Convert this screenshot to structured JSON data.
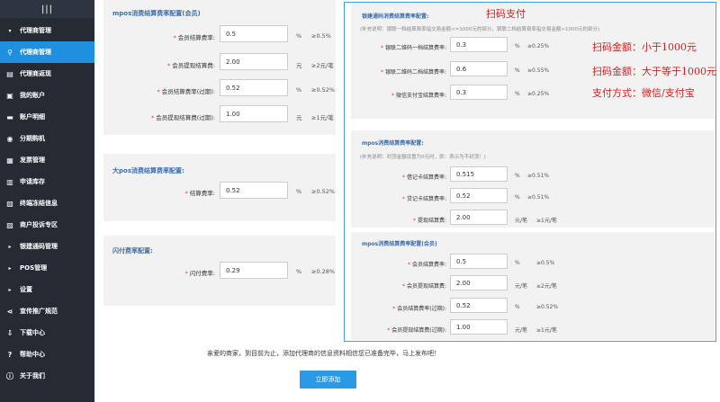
{
  "sidebar": {
    "top_icon": "|||",
    "items": [
      {
        "label": "代理商管理",
        "icon": "▾"
      },
      {
        "label": "代理商管理",
        "icon": "⚲"
      },
      {
        "label": "代理商返现",
        "icon": "▤"
      },
      {
        "label": "我的账户",
        "icon": "▣"
      },
      {
        "label": "账户明细",
        "icon": "▬"
      },
      {
        "label": "分期购机",
        "icon": "◉"
      },
      {
        "label": "发票管理",
        "icon": "▦"
      },
      {
        "label": "申请库存",
        "icon": "▥"
      },
      {
        "label": "终端冻结信息",
        "icon": "▧"
      },
      {
        "label": "商户投诉专区",
        "icon": "▨"
      },
      {
        "label": "银建通码管理",
        "icon": "▸"
      },
      {
        "label": "POS管理",
        "icon": "▸"
      },
      {
        "label": "设置",
        "icon": "▸"
      },
      {
        "label": "宣传推广规范",
        "icon": "⋖"
      },
      {
        "label": "下载中心",
        "icon": "⇩"
      },
      {
        "label": "帮助中心",
        "icon": "?"
      },
      {
        "label": "关于我们",
        "icon": "ⓘ"
      }
    ]
  },
  "mpos_member": {
    "title": "mpos消费结算费率配置(会员)",
    "rows": [
      {
        "label": "会员结算费率:",
        "value": "0.5",
        "unit": "%",
        "range": "≥0.5%"
      },
      {
        "label": "会员提现结算费:",
        "value": "2.00",
        "unit": "元",
        "range": "≥2元/笔"
      },
      {
        "label": "会员结算费率(过期):",
        "value": "0.52",
        "unit": "%",
        "range": "≥0.52%"
      },
      {
        "label": "会员提现结算费(过期):",
        "value": "1.00",
        "unit": "元",
        "range": "≥1元/笔"
      }
    ]
  },
  "big_pos": {
    "title": "大pos消费结算费率配置:",
    "rows": [
      {
        "label": "结算费率:",
        "value": "0.52",
        "unit": "%",
        "range": "≥0.52%"
      }
    ]
  },
  "flash_pay": {
    "title": "闪付费率配置:",
    "rows": [
      {
        "label": "闪付费率:",
        "value": "0.29",
        "unit": "%",
        "range": "≥0.28%"
      }
    ]
  },
  "scan_pay": {
    "title": "银建通码消费结算费率配置:",
    "hint": "(补充说明：银联一档结算费率指交易金额<=1000元的部分，银联二档结算费率指交易金额>1000元的部分)",
    "rows": [
      {
        "label": "银联二维码一档结算费率:",
        "value": "0.3",
        "unit": "%",
        "range": "≥0.25%"
      },
      {
        "label": "银联二维码二档结算费率:",
        "value": "0.6",
        "unit": "%",
        "range": "≥0.55%"
      },
      {
        "label": "微信支付宝结算费率:",
        "value": "0.3",
        "unit": "%",
        "range": "≥0.25%"
      }
    ]
  },
  "mpos_cost": {
    "title": "mpos消费结算费率配置:",
    "hint": "(补充说明：封顶金额设置为0元时，即：表示为不封顶！)",
    "rows": [
      {
        "label": "借记卡结算费率:",
        "value": "0.515",
        "unit": "%",
        "range": "≥0.51%"
      },
      {
        "label": "贷记卡结算费率:",
        "value": "0.52",
        "unit": "%",
        "range": "≥0.51%"
      },
      {
        "label": "提现结算费:",
        "value": "2.00",
        "unit": "元/笔",
        "range": "≥1元/笔"
      }
    ]
  },
  "mpos_cost_member": {
    "title": "mpos消费结算费率配置(会员)",
    "rows": [
      {
        "label": "会员结算费率:",
        "value": "0.5",
        "unit": "%",
        "range": "≥0.5%"
      },
      {
        "label": "会员提现结算费:",
        "value": "2.00",
        "unit": "元/笔",
        "range": "≥2元/笔"
      },
      {
        "label": "会员结算费率(过期):",
        "value": "0.52",
        "unit": "%",
        "range": "≥0.52%"
      },
      {
        "label": "会员提现结算费(过期):",
        "value": "1.00",
        "unit": "元/笔",
        "range": "≥1元/笔"
      }
    ]
  },
  "annotations": {
    "a1": "扫码支付",
    "a2": "扫码金额：小于1000元",
    "a3": "扫码金额：大于等于1000元",
    "a4": "支付方式：微信/支付宝"
  },
  "footer": {
    "message": "亲爱的商家，到目前为止，添加代理商的信息资料相信您已准备完毕，马上发布吧！",
    "submit": "立即添加"
  },
  "colors": {
    "accent": "#1f8fe0",
    "sidebar": "#262b33",
    "annotation": "#d81e1e",
    "highlight": "#3ea0e0"
  }
}
